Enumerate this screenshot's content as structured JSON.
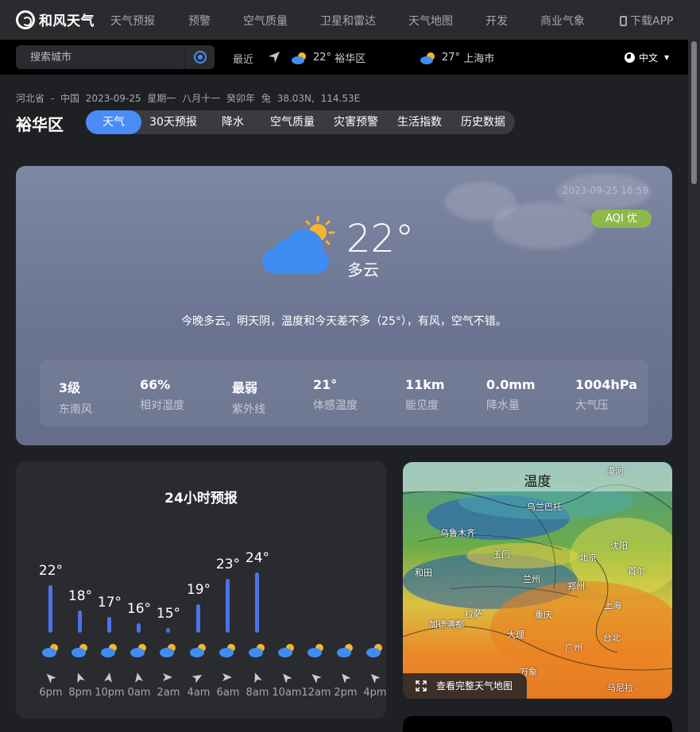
{
  "brand": {
    "name": "和风天气"
  },
  "nav": {
    "items": [
      "天气预报",
      "预警",
      "空气质量",
      "卫星和雷达",
      "天气地图",
      "开发",
      "商业气象"
    ],
    "download": "下载APP"
  },
  "search": {
    "placeholder": "搜索城市"
  },
  "recent": {
    "label": "最近",
    "cities": [
      {
        "temp": "22°",
        "name": "裕华区",
        "icon": "partly-cloudy-icon"
      },
      {
        "temp": "27°",
        "name": "上海市",
        "icon": "partly-cloudy-icon"
      }
    ]
  },
  "language": {
    "label": "中文"
  },
  "location": {
    "region": "河北省 - 中国",
    "date": "2023-09-25",
    "weekday": "星期一",
    "lunar": "八月十一 癸卯年 兔",
    "coords": "38.03N, 114.53E",
    "city": "裕华区"
  },
  "tabs": [
    "天气",
    "30天预报",
    "降水",
    "空气质量",
    "灾害预警",
    "生活指数",
    "历史数据"
  ],
  "current": {
    "obs_time": "2023-09-25 16:58",
    "aqi": "AQI 优",
    "temp": "22°",
    "condition": "多云",
    "summary": "今晚多云。明天阴，温度和今天差不多（25°），有风，空气不错。",
    "icon": "partly-cloudy-icon",
    "stats": [
      {
        "value": "3级",
        "label": "东南风"
      },
      {
        "value": "66%",
        "label": "相对湿度"
      },
      {
        "value": "最弱",
        "label": "紫外线"
      },
      {
        "value": "21°",
        "label": "体感温度"
      },
      {
        "value": "11km",
        "label": "能见度"
      },
      {
        "value": "0.0mm",
        "label": "降水量"
      },
      {
        "value": "1004hPa",
        "label": "大气压"
      }
    ]
  },
  "hourly": {
    "title": "24小时预报",
    "hours": [
      {
        "time": "6pm",
        "temp": "22°",
        "value": 22
      },
      {
        "time": "8pm",
        "temp": "18°",
        "value": 18
      },
      {
        "time": "10pm",
        "temp": "17°",
        "value": 17
      },
      {
        "time": "0am",
        "temp": "16°",
        "value": 16
      },
      {
        "time": "2am",
        "temp": "15°",
        "value": 15
      },
      {
        "time": "4am",
        "temp": "19°",
        "value": 19
      },
      {
        "time": "6am",
        "temp": "23°",
        "value": 23
      },
      {
        "time": "8am",
        "temp": "24°",
        "value": 24
      }
    ],
    "axis_labels": [
      "6pm",
      "8pm",
      "10pm",
      "0am",
      "2am",
      "4am",
      "6am",
      "8am",
      "10am",
      "12am",
      "2pm",
      "4pm"
    ]
  },
  "map": {
    "title": "温度",
    "labels": [
      "漠河",
      "乌兰巴托",
      "乌鲁木齐",
      "沈阳",
      "玉门",
      "北京",
      "首尔",
      "和田",
      "兰州",
      "郑州",
      "拉萨",
      "重庆",
      "上海",
      "加德满都",
      "大理",
      "台北",
      "广州",
      "万象",
      "马尼拉"
    ],
    "button": "查看完整天气地图"
  },
  "colors": {
    "accent": "#4a8cf5",
    "aqi_good": "#8db94a",
    "bar": "#4a74ea",
    "sun": "#f7b52c",
    "cloud": "#3f8df3"
  }
}
